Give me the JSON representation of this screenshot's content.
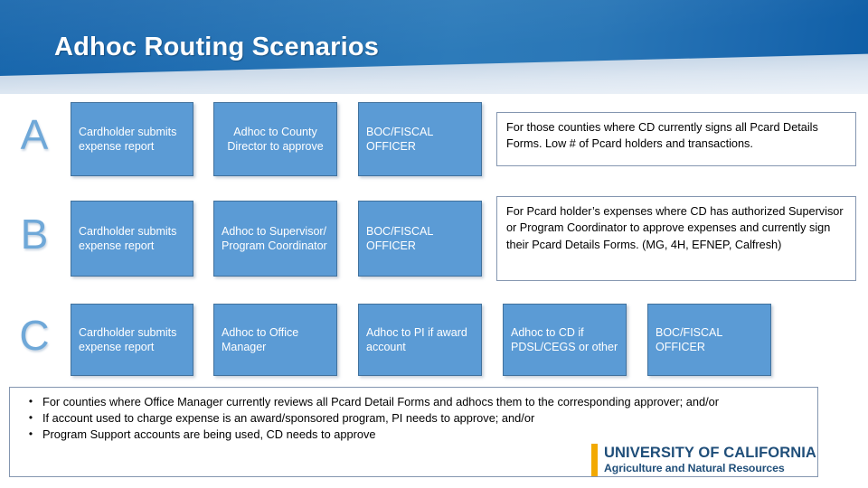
{
  "header": {
    "title": "Adhoc Routing Scenarios",
    "gradient_start": "#1464ab",
    "gradient_mid": "#2d7bba"
  },
  "theme": {
    "cell_fill": "#5B9BD5",
    "cell_border": "#41719C",
    "note_border": "#8496B0",
    "letter_color": "#6fa8d8",
    "logo_bar": "#F2A900",
    "logo_text": "#1F4E79"
  },
  "rows": [
    {
      "letter": "A",
      "steps": [
        "Cardholder submits expense report",
        "Adhoc to County Director to approve",
        "BOC/FISCAL OFFICER"
      ],
      "note": "For those counties where CD currently signs all Pcard Details Forms. Low # of Pcard holders and transactions."
    },
    {
      "letter": "B",
      "steps": [
        "Cardholder submits expense report",
        "Adhoc to Supervisor/ Program Coordinator",
        "BOC/FISCAL OFFICER"
      ],
      "note": "For Pcard holder’s expenses where CD has authorized Supervisor or Program Coordinator to approve expenses and currently sign their Pcard Details Forms. (MG, 4H, EFNEP, Calfresh)"
    },
    {
      "letter": "C",
      "steps": [
        "Cardholder submits expense report",
        "Adhoc to Office Manager",
        "Adhoc to PI if award account",
        "Adhoc to CD if PDSL/CEGS or other",
        "BOC/FISCAL OFFICER"
      ],
      "note": ""
    }
  ],
  "bullets": {
    "marker": "•",
    "items": [
      "For counties where Office Manager currently reviews all Pcard Detail Forms and adhocs them to the corresponding approver; and/or",
      "If account used to charge expense is an award/sponsored program, PI needs to approve; and/or",
      "Program Support accounts are being used, CD needs to approve"
    ]
  },
  "logo": {
    "line1": "UNIVERSITY OF CALIFORNIA",
    "line2": "Agriculture and Natural Resources"
  }
}
